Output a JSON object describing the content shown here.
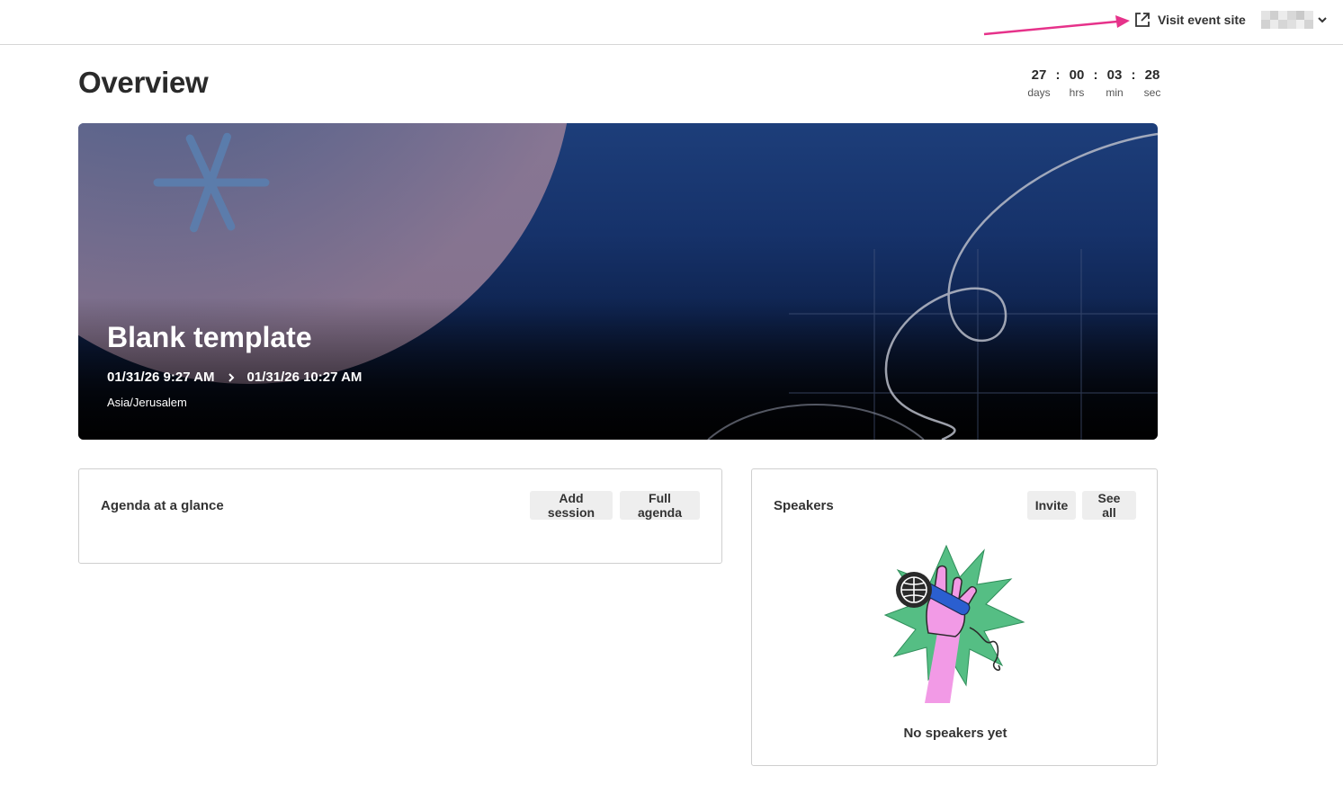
{
  "header": {
    "visit_label": "Visit event site",
    "accent": "#e6328a"
  },
  "page": {
    "title": "Overview"
  },
  "countdown": [
    {
      "value": "27",
      "unit": "days"
    },
    {
      "value": "00",
      "unit": "hrs"
    },
    {
      "value": "03",
      "unit": "min"
    },
    {
      "value": "28",
      "unit": "sec"
    }
  ],
  "countdown_sep": ":",
  "event": {
    "title": "Blank template",
    "start": "01/31/26 9:27 AM",
    "end": "01/31/26 10:27 AM",
    "timezone": "Asia/Jerusalem"
  },
  "agenda": {
    "title": "Agenda at a glance",
    "add_label": "Add session",
    "full_label": "Full agenda"
  },
  "speakers": {
    "title": "Speakers",
    "invite_label": "Invite",
    "see_all_label": "See all",
    "empty_text": "No speakers yet"
  },
  "icons": {
    "visit": "external-link-icon",
    "chevron": "chevron-down-icon",
    "date_sep": "chevron-right-icon"
  }
}
